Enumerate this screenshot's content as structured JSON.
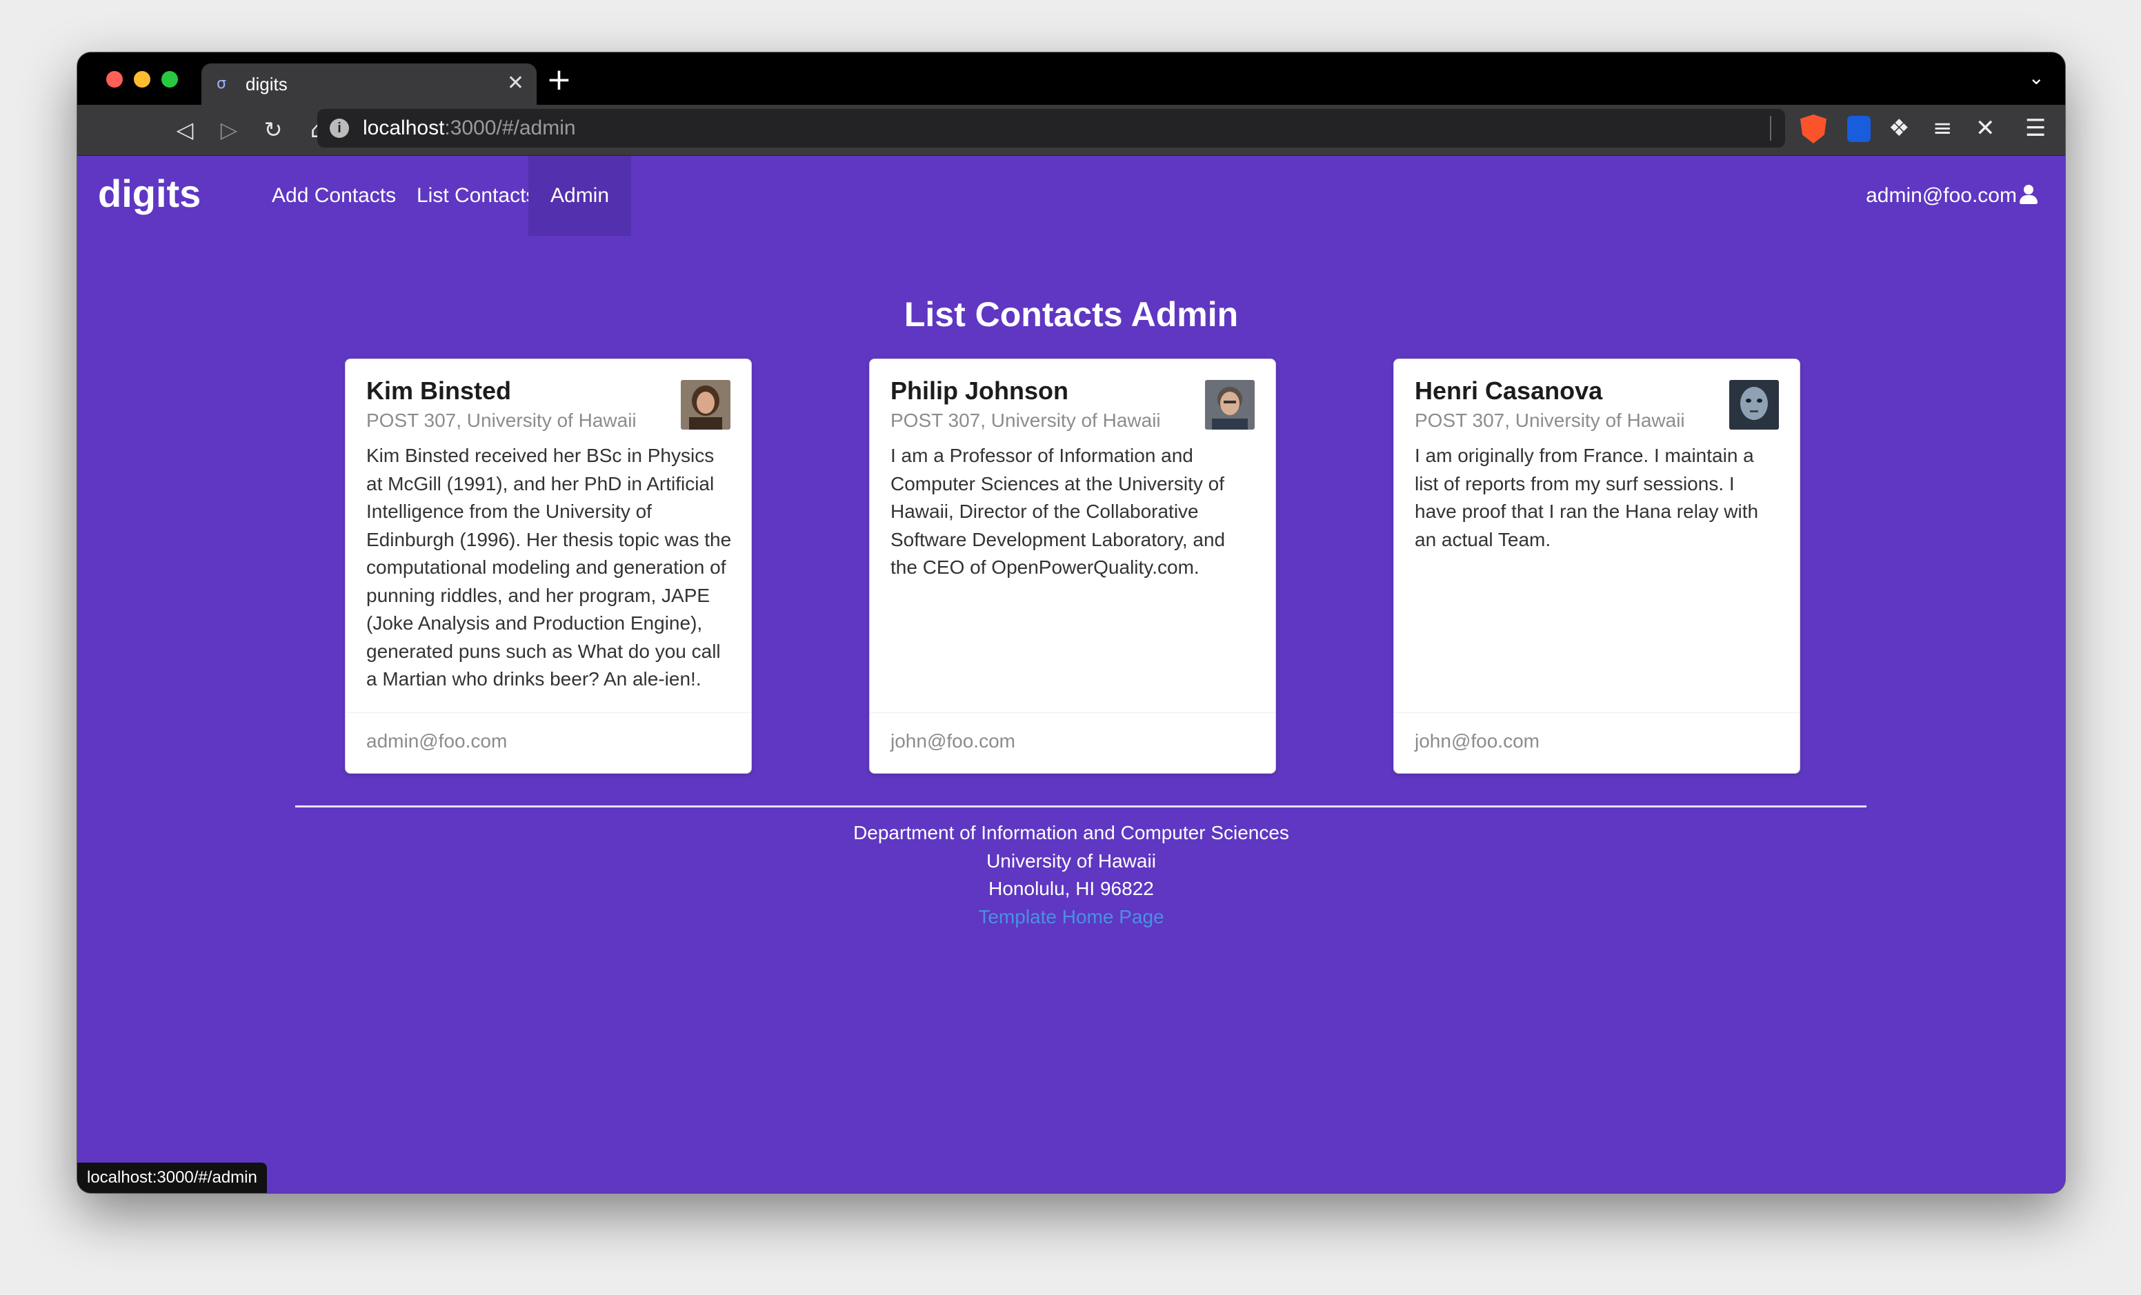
{
  "browser": {
    "tab_title": "digits",
    "url_host": "localhost",
    "url_path": ":3000/#/admin",
    "status_url": "localhost:3000/#/admin"
  },
  "navbar": {
    "brand": "digits",
    "items": [
      {
        "label": "Add Contacts"
      },
      {
        "label": "List Contacts"
      },
      {
        "label": "Admin"
      }
    ],
    "user": "admin@foo.com"
  },
  "main": {
    "title": "List Contacts Admin",
    "contacts": [
      {
        "name": "Kim Binsted",
        "address": "POST 307, University of Hawaii",
        "description": "Kim Binsted received her BSc in Physics at McGill (1991), and her PhD in Artificial Intelligence from the University of Edinburgh (1996). Her thesis topic was the computational modeling and generation of punning riddles, and her program, JAPE (Joke Analysis and Production Engine), generated puns such as What do you call a Martian who drinks beer? An ale-ien!.",
        "owner": "admin@foo.com"
      },
      {
        "name": "Philip Johnson",
        "address": "POST 307, University of Hawaii",
        "description": "I am a Professor of Information and Computer Sciences at the University of Hawaii, Director of the Collaborative Software Development Laboratory, and the CEO of OpenPowerQuality.com.",
        "owner": "john@foo.com"
      },
      {
        "name": "Henri Casanova",
        "address": "POST 307, University of Hawaii",
        "description": "I am originally from France. I maintain a list of reports from my surf sessions. I have proof that I ran the Hana relay with an actual Team.",
        "owner": "john@foo.com"
      }
    ]
  },
  "footer": {
    "line1": "Department of Information and Computer Sciences",
    "line2": "University of Hawaii",
    "line3": "Honolulu, HI 96822",
    "link": "Template Home Page"
  },
  "colors": {
    "page_background": "#5f37c2",
    "active_nav": "#5330ad",
    "link": "#4a90e2"
  }
}
